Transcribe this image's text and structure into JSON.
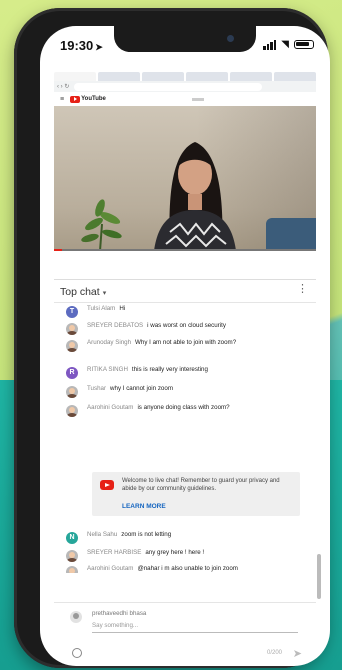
{
  "status": {
    "time": "19:30"
  },
  "browser": {
    "tabs": [
      "",
      "",
      "",
      "",
      "",
      ""
    ],
    "url": ""
  },
  "video": {
    "title": "",
    "subtitle": "",
    "actions": [
      "",
      "",
      "",
      "",
      ""
    ]
  },
  "chat": {
    "header": "Top chat",
    "messages": [
      {
        "author": "Tulsi Alam",
        "text": "Hi",
        "avatar": "letter",
        "letter": "T",
        "color": "#5c6bc0"
      },
      {
        "author": "SREYER DEBATOS",
        "text": "i was worst on cloud security",
        "avatar": "photo"
      },
      {
        "author": "Arunoday Singh",
        "text": "Why I am not able to join with zoom?",
        "avatar": "photo"
      },
      {
        "author": "RITIKA SINGH",
        "text": "this is really very interesting",
        "avatar": "letter",
        "letter": "R",
        "color": "#7e57c2"
      },
      {
        "author": "Tushar",
        "text": "why I cannot join zoom",
        "avatar": "photo"
      },
      {
        "author": "Aarohini Goutam",
        "text": "is anyone doing class with zoom?",
        "avatar": "photo"
      },
      {
        "author": "Nella Sahu",
        "text": "zoom is not letting",
        "avatar": "letter",
        "letter": "N",
        "color": "#26a69a"
      },
      {
        "author": "SREYER HARBISE",
        "text": "any grey here ! here !",
        "avatar": "photo"
      },
      {
        "author": "Aarohini Goutam",
        "text": "@nahar i m also unable to join zoom",
        "avatar": "photo"
      }
    ],
    "notice": {
      "text": "Welcome to live chat! Remember to guard your privacy and abide by our community guidelines.",
      "link": "LEARN MORE"
    },
    "input": {
      "name": "prethaveedhi bhasa",
      "placeholder": "Say something...",
      "counter": "0/200"
    }
  }
}
